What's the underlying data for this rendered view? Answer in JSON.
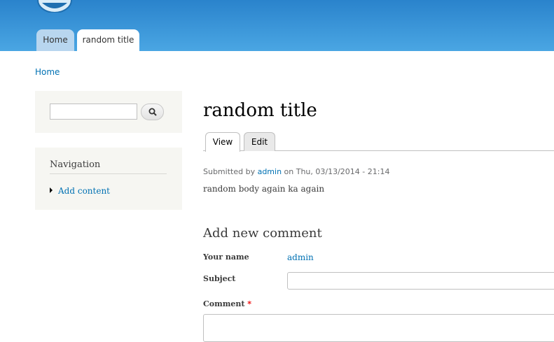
{
  "header": {
    "tabs": [
      {
        "label": "Home",
        "active": false
      },
      {
        "label": "random title",
        "active": true
      }
    ],
    "colors": {
      "bar_top": "#2a83cc",
      "bar_bottom": "#4aa6e3"
    }
  },
  "breadcrumb": {
    "home": "Home"
  },
  "sidebar": {
    "search": {
      "value": "",
      "button_icon": "search-icon"
    },
    "navigation": {
      "title": "Navigation",
      "items": [
        {
          "label": "Add content"
        }
      ]
    }
  },
  "main": {
    "title": "random title",
    "tabs": [
      {
        "label": "View"
      },
      {
        "label": "Edit"
      }
    ],
    "meta": {
      "prefix": "Submitted by",
      "author": "admin",
      "date_text": "on Thu, 03/13/2014 - 21:14"
    },
    "body": "random body again ka again"
  },
  "comment_form": {
    "title": "Add new comment",
    "name_label": "Your name",
    "name_value": "admin",
    "subject_label": "Subject",
    "subject_value": "",
    "comment_label": "Comment",
    "required_marker": "*"
  }
}
